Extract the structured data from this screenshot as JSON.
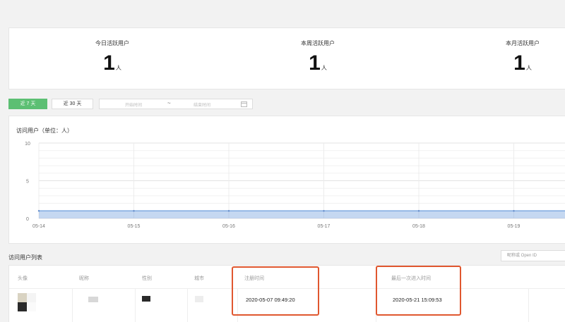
{
  "stats": [
    {
      "label": "今日活跃用户",
      "value": "1",
      "unit": "人"
    },
    {
      "label": "本周活跃用户",
      "value": "1",
      "unit": "人"
    },
    {
      "label": "本月活跃用户",
      "value": "1",
      "unit": "人"
    }
  ],
  "filters": {
    "btn_7days": "近 7 天",
    "btn_30days": "近 30 天",
    "active": "近 7 天",
    "start_placeholder": "开始时间",
    "separator": "~",
    "end_placeholder": "结束时间"
  },
  "chart_title": "访问用户（单位：人）",
  "chart_data": {
    "type": "area",
    "categories": [
      "05-14",
      "05-15",
      "05-16",
      "05-17",
      "05-18",
      "05-19"
    ],
    "series": [
      {
        "values": [
          1,
          1,
          1,
          1,
          1,
          1
        ]
      }
    ],
    "yticks": [
      0,
      5,
      10
    ],
    "ylim": [
      0,
      10
    ],
    "grid": true,
    "series_color": "#7ea8e0"
  },
  "visitor_list": {
    "title": "访问用户列表",
    "search_placeholder": "昵称或 Open ID",
    "columns": [
      "头像",
      "昵称",
      "性别",
      "城市",
      "注册时间",
      "最后一次进入时间"
    ],
    "rows": [
      {
        "register_time": "2020-05-07 09:49:20",
        "last_visit_time": "2020-05-21 15:09:53"
      }
    ]
  },
  "colors": {
    "accent_green": "#5cbf73",
    "highlight_red": "#e0572f"
  }
}
